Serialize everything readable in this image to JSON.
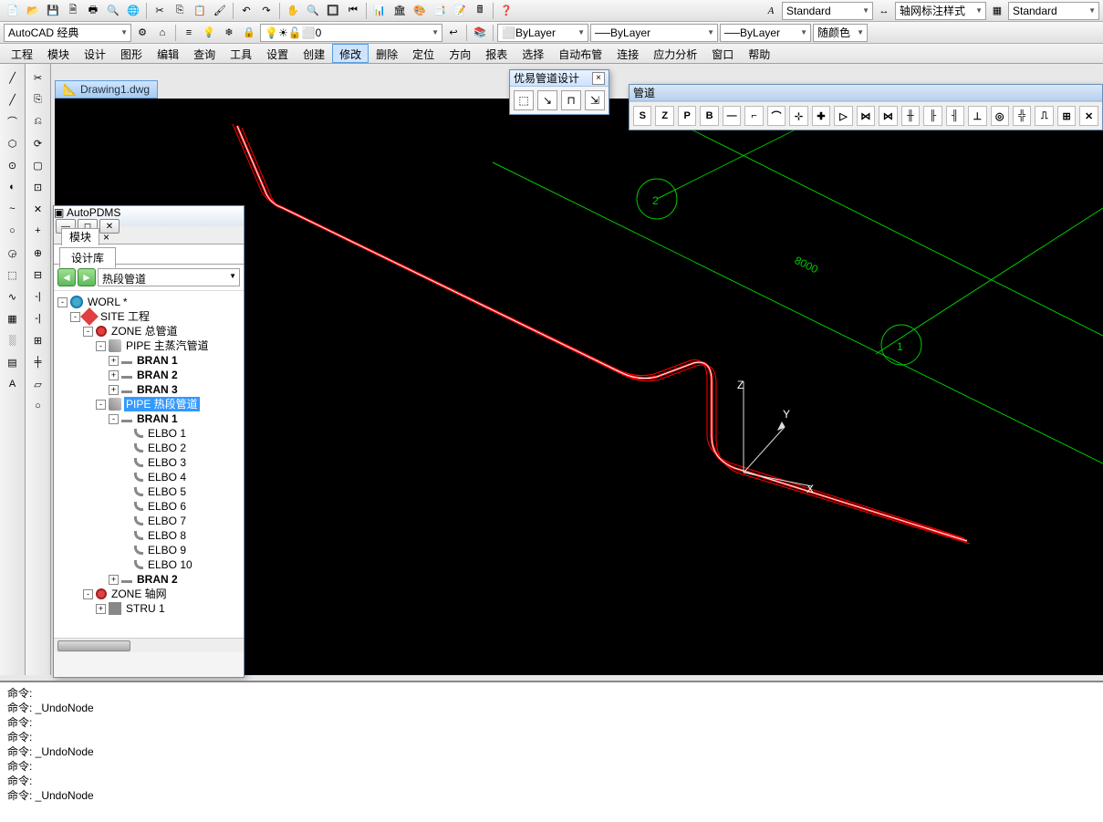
{
  "top_combos": {
    "text_style": "Standard",
    "dim_style": "轴网标注样式",
    "table_style": "Standard"
  },
  "row2": {
    "workspace": "AutoCAD 经典",
    "layer": "0",
    "layer_line1": "ByLayer",
    "layer_line2": "ByLayer",
    "layer_line3": "ByLayer",
    "color": "随颜色"
  },
  "menu": [
    "工程",
    "模块",
    "设计",
    "图形",
    "编辑",
    "查询",
    "工具",
    "设置",
    "创建",
    "修改",
    "删除",
    "定位",
    "方向",
    "报表",
    "选择",
    "自动布管",
    "连接",
    "应力分析",
    "窗口",
    "帮助"
  ],
  "menu_active_index": 9,
  "drawtab": "Drawing1.dwg",
  "float_panel": {
    "title": "优易管道设计",
    "buttons": [
      "⬚",
      "↘",
      "⊓",
      "⇲"
    ]
  },
  "pipe_toolbar": {
    "title": "管道",
    "buttons": [
      "S",
      "Z",
      "P",
      "B",
      "—",
      "⌐",
      "⌒",
      "⊹",
      "✚",
      "▷",
      "⋈",
      "⋈",
      "╫",
      "╟",
      "╢",
      "⊥",
      "◎",
      "╬",
      "⎍",
      "⊞",
      "✕"
    ]
  },
  "pdms": {
    "title": "AutoPDMS",
    "tab1": "模块",
    "tab2": "设计库",
    "nav_label": "热段管道"
  },
  "tree": [
    {
      "d": 0,
      "t": "-",
      "i": "globe",
      "l": "WORL *"
    },
    {
      "d": 1,
      "t": "-",
      "i": "site",
      "l": "SITE 工程"
    },
    {
      "d": 2,
      "t": "-",
      "i": "zone",
      "l": "ZONE 总管道"
    },
    {
      "d": 3,
      "t": "-",
      "i": "pipe",
      "l": "PIPE 主蒸汽管道"
    },
    {
      "d": 4,
      "t": "+",
      "i": "bran",
      "l": "BRAN 1",
      "b": true
    },
    {
      "d": 4,
      "t": "+",
      "i": "bran",
      "l": "BRAN 2",
      "b": true
    },
    {
      "d": 4,
      "t": "+",
      "i": "bran",
      "l": "BRAN 3",
      "b": true
    },
    {
      "d": 3,
      "t": "-",
      "i": "pipe",
      "l": "PIPE 热段管道",
      "sel": true
    },
    {
      "d": 4,
      "t": "-",
      "i": "bran",
      "l": "BRAN 1",
      "b": true
    },
    {
      "d": 5,
      "t": "",
      "i": "elbo",
      "l": "ELBO 1"
    },
    {
      "d": 5,
      "t": "",
      "i": "elbo",
      "l": "ELBO 2"
    },
    {
      "d": 5,
      "t": "",
      "i": "elbo",
      "l": "ELBO 3"
    },
    {
      "d": 5,
      "t": "",
      "i": "elbo",
      "l": "ELBO 4"
    },
    {
      "d": 5,
      "t": "",
      "i": "elbo",
      "l": "ELBO 5"
    },
    {
      "d": 5,
      "t": "",
      "i": "elbo",
      "l": "ELBO 6"
    },
    {
      "d": 5,
      "t": "",
      "i": "elbo",
      "l": "ELBO 7"
    },
    {
      "d": 5,
      "t": "",
      "i": "elbo",
      "l": "ELBO 8"
    },
    {
      "d": 5,
      "t": "",
      "i": "elbo",
      "l": "ELBO 9"
    },
    {
      "d": 5,
      "t": "",
      "i": "elbo",
      "l": "ELBO 10"
    },
    {
      "d": 4,
      "t": "+",
      "i": "bran",
      "l": "BRAN 2",
      "b": true
    },
    {
      "d": 2,
      "t": "-",
      "i": "zone",
      "l": "ZONE 轴网"
    },
    {
      "d": 3,
      "t": "+",
      "i": "stru",
      "l": "STRU 1"
    }
  ],
  "canvas": {
    "dim_text": "8000",
    "axis": {
      "z": "Z",
      "y": "Y",
      "x": "X"
    },
    "circle_labels": [
      "2",
      "1"
    ]
  },
  "cmd": {
    "prompt": "命令:",
    "lines": [
      "命令:",
      "命令: _UndoNode",
      "命令:",
      "命令:",
      "命令: _UndoNode",
      "命令:",
      "命令:",
      "命令: _UndoNode"
    ]
  },
  "left_tools_a": [
    "╱",
    "╱",
    "⌒",
    "⬡",
    "⊙",
    "◐",
    "~",
    "○",
    "◶",
    "⬚",
    "∿",
    "▦",
    "░",
    "▤",
    "A"
  ],
  "left_tools_b": [
    "✂",
    "⎘",
    "⎌",
    "⟳",
    "▢",
    "⊡",
    "✕",
    "+",
    "⊕",
    "⊟",
    "-|",
    "-|",
    "⊞",
    "╪",
    "⏥",
    "○"
  ]
}
